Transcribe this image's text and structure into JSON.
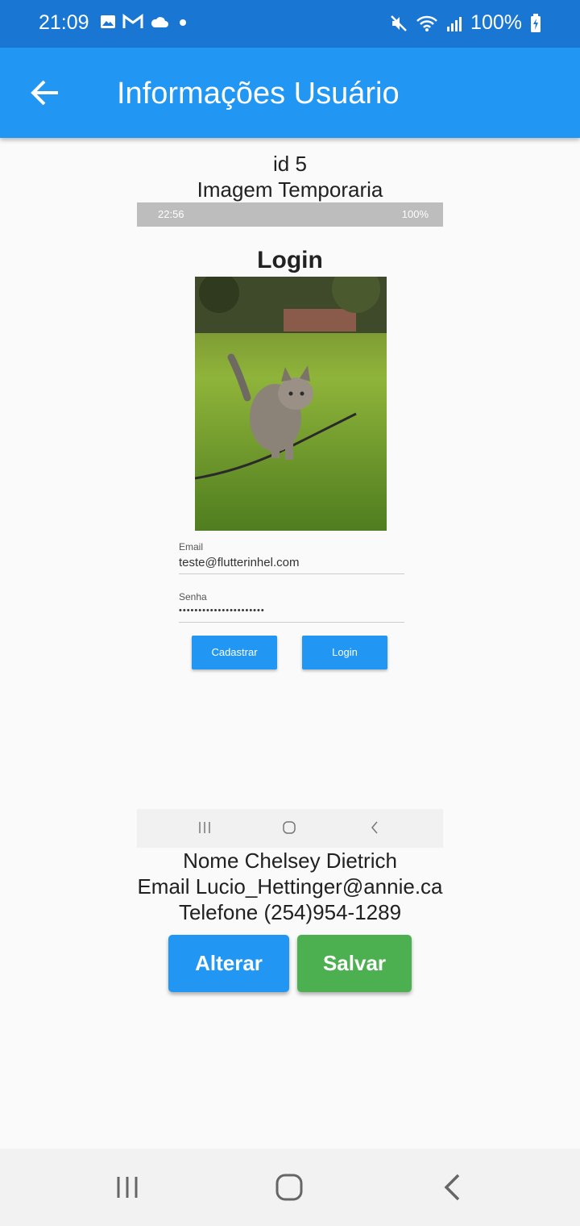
{
  "status_bar": {
    "time": "21:09",
    "battery": "100%"
  },
  "app_bar": {
    "title": "Informações Usuário"
  },
  "user": {
    "id_line": "id 5",
    "image_caption": "Imagem Temporaria",
    "name_line": "Nome Chelsey Dietrich",
    "email_line": "Email Lucio_Hettinger@annie.ca",
    "phone_line": "Telefone (254)954-1289"
  },
  "embedded_screenshot": {
    "status_time": "22:56",
    "status_battery": "100%",
    "title": "Login",
    "email_label": "Email",
    "email_value": "teste@flutterinhel.com",
    "password_label": "Senha",
    "password_value": "••••••••••••••••••••••",
    "register_label": "Cadastrar",
    "login_label": "Login"
  },
  "actions": {
    "alter_label": "Alterar",
    "save_label": "Salvar"
  },
  "colors": {
    "status_bar": "#1976d2",
    "app_bar": "#2196f3",
    "alter_button": "#2196f3",
    "save_button": "#4caf50"
  }
}
